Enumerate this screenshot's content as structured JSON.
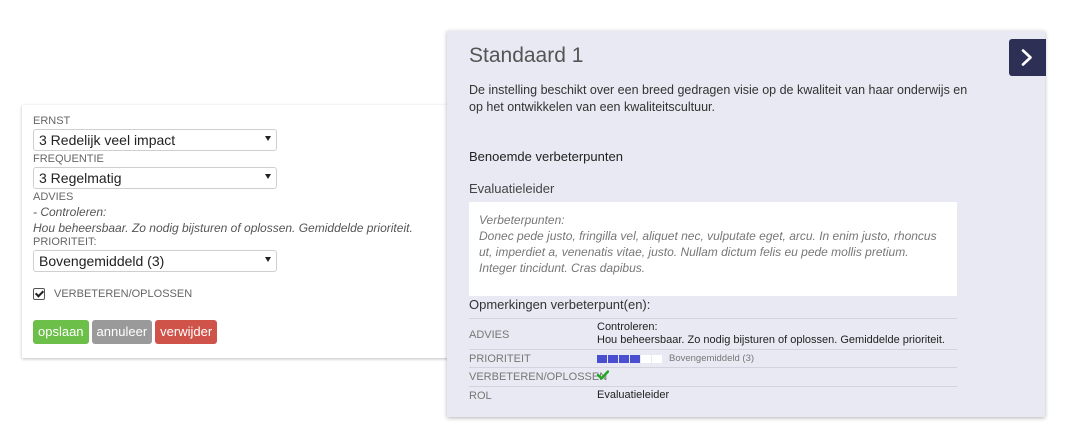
{
  "form": {
    "ernst": {
      "label": "ERNST",
      "value": "3 Redelijk veel impact"
    },
    "frequentie": {
      "label": "FREQUENTIE",
      "value": "3 Regelmatig"
    },
    "advies": {
      "label": "ADVIES",
      "line1": "- Controleren:",
      "line2": "Hou beheersbaar. Zo nodig bijsturen of oplossen. Gemiddelde prioriteit."
    },
    "prioriteit": {
      "label": "PRIORITEIT:",
      "value": "Bovengemiddeld (3)"
    },
    "checkbox": {
      "label": "VERBETEREN/OPLOSSEN",
      "checked": true
    },
    "buttons": {
      "save": "opslaan",
      "cancel": "annuleer",
      "delete": "verwijder"
    }
  },
  "panel": {
    "title": "Standaard 1",
    "description": "De instelling beschikt over een breed gedragen visie op de kwaliteit van haar onderwijs en op het ontwikkelen van een kwaliteitscultuur.",
    "section_title": "Benoemde verbeterpunten",
    "evaluator": "Evaluatieleider",
    "note": {
      "heading": "Verbeterpunten:",
      "body": "Donec pede justo, fringilla vel, aliquet nec, vulputate eget, arcu. In enim justo, rhoncus ut, imperdiet a, venenatis vitae, justo. Nullam dictum felis eu pede mollis pretium. Integer tincidunt. Cras dapibus."
    },
    "remarks_title": "Opmerkingen verbeterpunt(en):",
    "props": {
      "advies": {
        "key": "ADVIES",
        "line1": "Controleren:",
        "line2": "Hou beheersbaar. Zo nodig bijsturen of oplossen. Gemiddelde prioriteit."
      },
      "prioriteit": {
        "key": "PRIORITEIT",
        "level": 4,
        "max": 6,
        "text": "Bovengemiddeld (3)"
      },
      "verbeteren": {
        "key": "VERBETEREN/OPLOSSEN",
        "icon": "check-icon"
      },
      "rol": {
        "key": "ROL",
        "value": "Evaluatieleider"
      }
    }
  },
  "colors": {
    "save": "#6cc04a",
    "cancel": "#9a9a9a",
    "delete": "#d0534a",
    "panel_bg": "#e8e9f2",
    "nav_button": "#2d2f55",
    "priority_on": "#4a4fcf",
    "check": "#22a722"
  }
}
